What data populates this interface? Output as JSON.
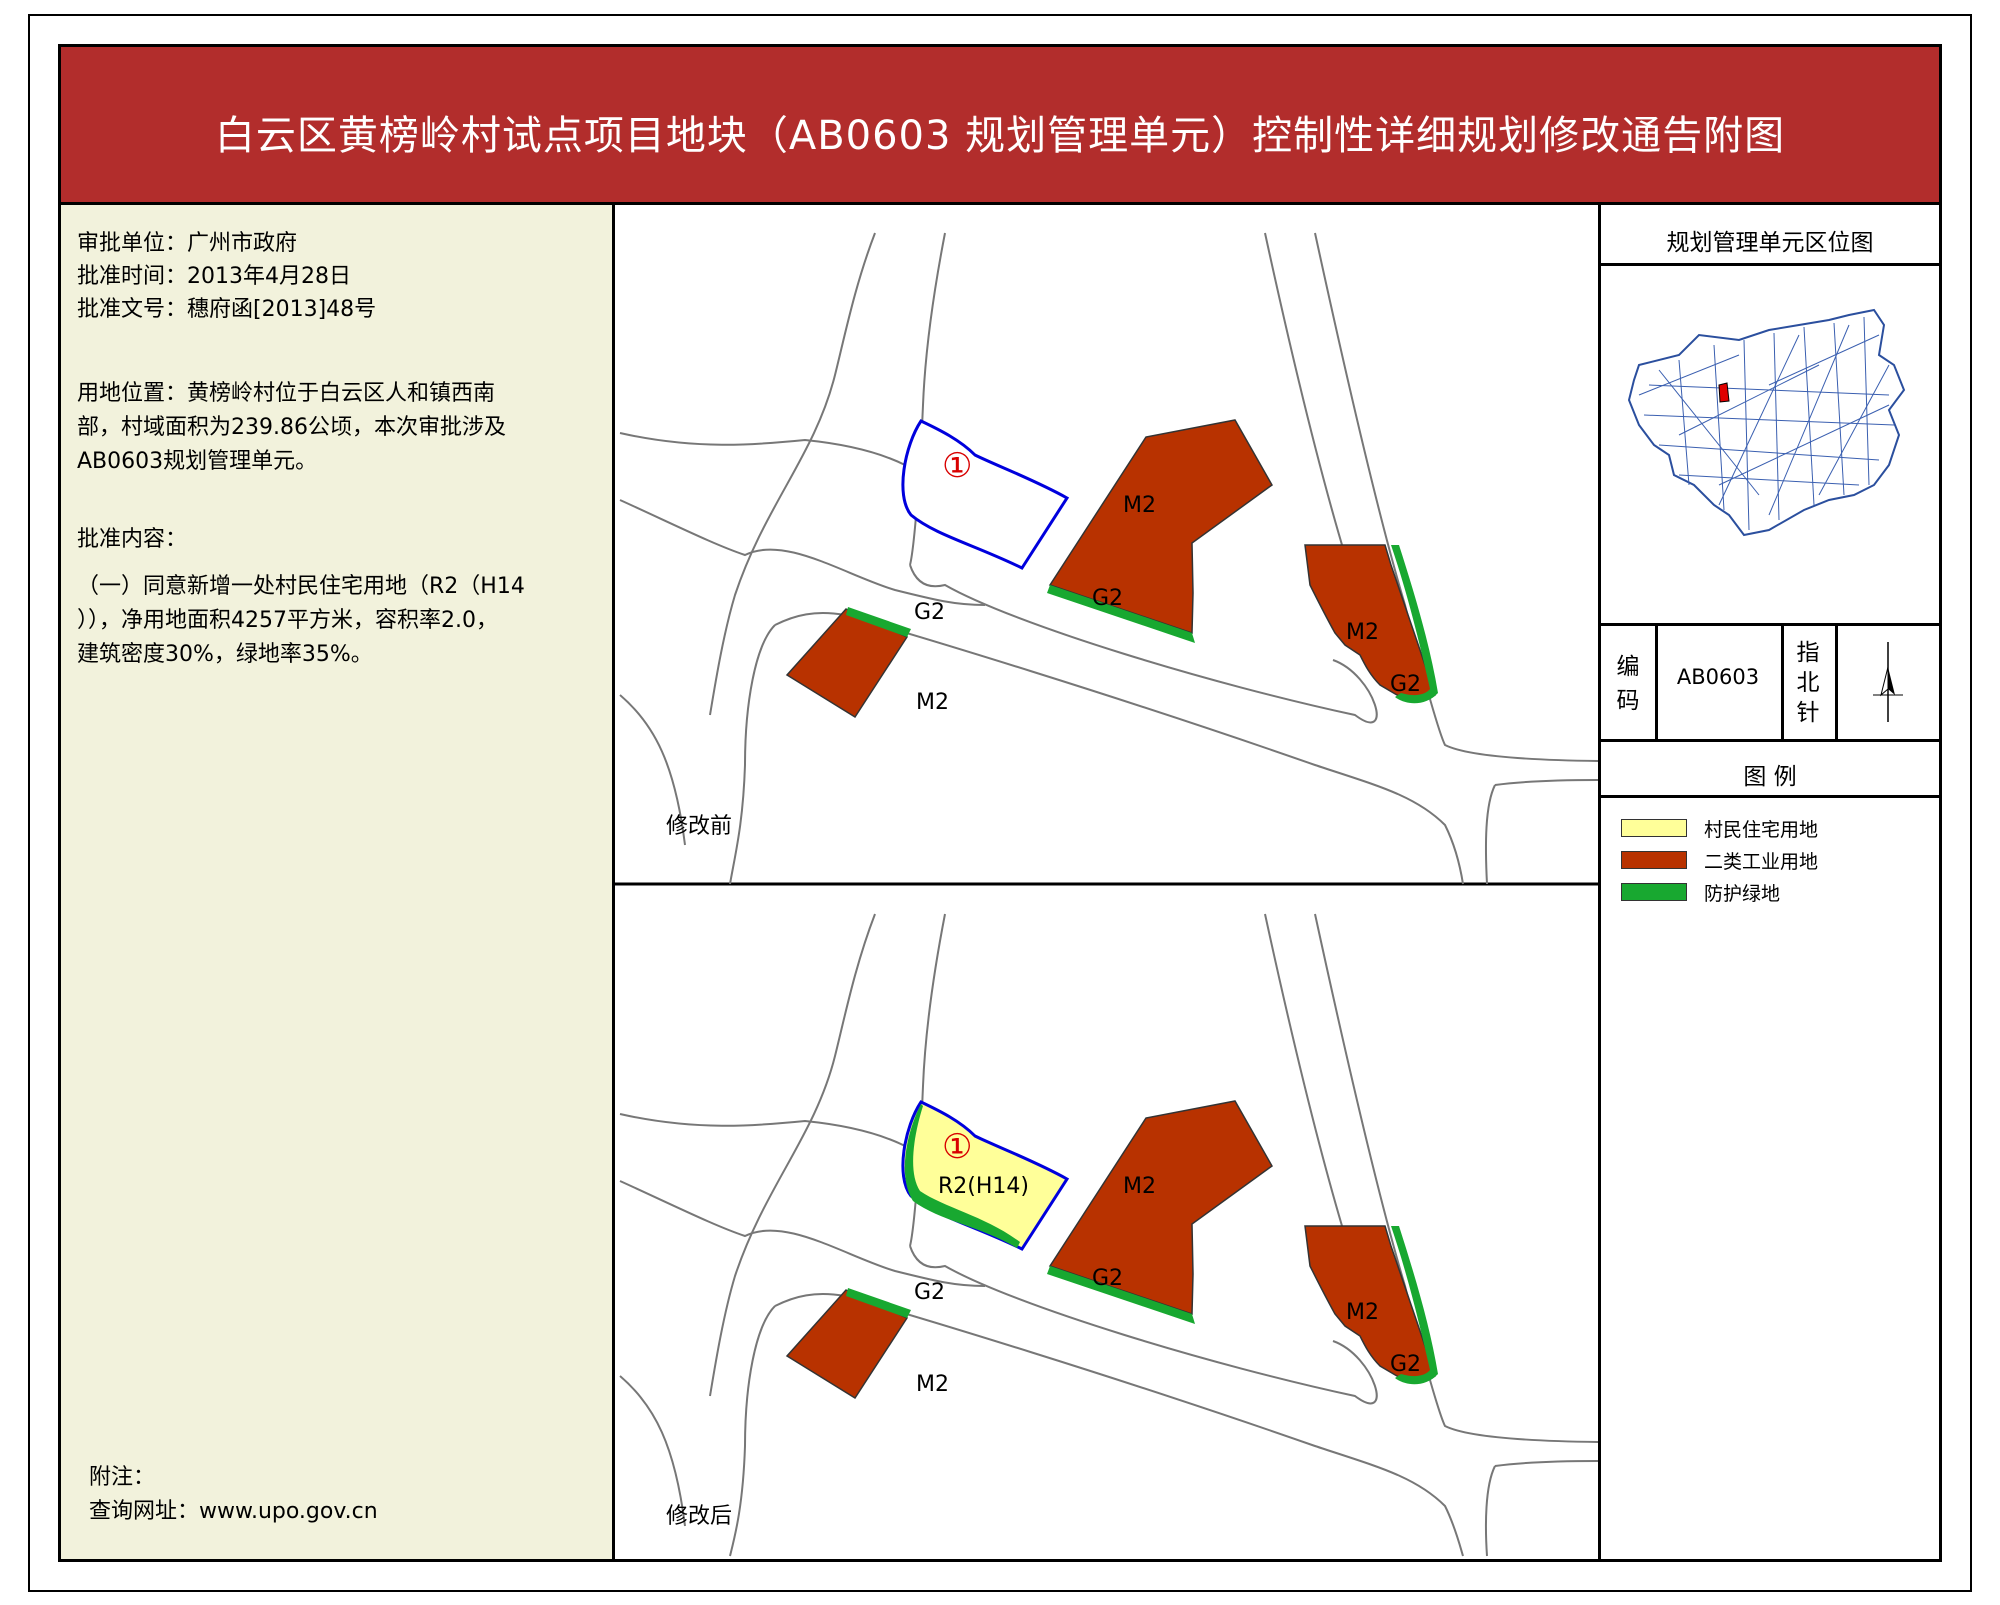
{
  "title": "白云区黄榜岭村试点项目地块（AB0603 规划管理单元）控制性详细规划修改通告附图",
  "left_panel": {
    "approval_unit": "审批单位：广州市政府",
    "approval_date": "批准时间：2013年4月28日",
    "approval_doc": "批准文号：穗府函[2013]48号",
    "location_line1": "用地位置：黄榜岭村位于白云区人和镇西南",
    "location_line2": "部，村域面积为239.86公顷，本次审批涉及",
    "location_line3": "AB0603规划管理单元。",
    "content_heading": "批准内容：",
    "content_line1": "（一）同意新增一处村民住宅用地（R2（H14",
    "content_line2": "）），净用地面积4257平方米，容积率2.0，",
    "content_line3": "建筑密度30%，绿地率35%。",
    "note_heading": "附注：",
    "note_url": "查询网址：www.upo.gov.cn"
  },
  "right_panel": {
    "location_map_heading": "规划管理单元区位图",
    "code_label_1": "编",
    "code_label_2": "码",
    "code_value": "AB0603",
    "north_label_1": "指",
    "north_label_2": "北",
    "north_label_3": "针",
    "legend_heading": "图  例",
    "legend": [
      {
        "label": "村民住宅用地",
        "color": "#ffff99"
      },
      {
        "label": "二类工业用地",
        "color": "#b83200"
      },
      {
        "label": "防护绿地",
        "color": "#18a830"
      }
    ]
  },
  "maps": {
    "before_label": "修改前",
    "after_label": "修改后",
    "parcel_marker": "①",
    "label_m2": "M2",
    "label_g2": "G2",
    "label_r2": "R2(H14)"
  },
  "colors": {
    "header": "#b22d2c",
    "panel_bg": "#f2f2dc",
    "industrial": "#b83200",
    "green": "#18a830",
    "residential": "#ffff99",
    "boundary": "#0000dd"
  }
}
